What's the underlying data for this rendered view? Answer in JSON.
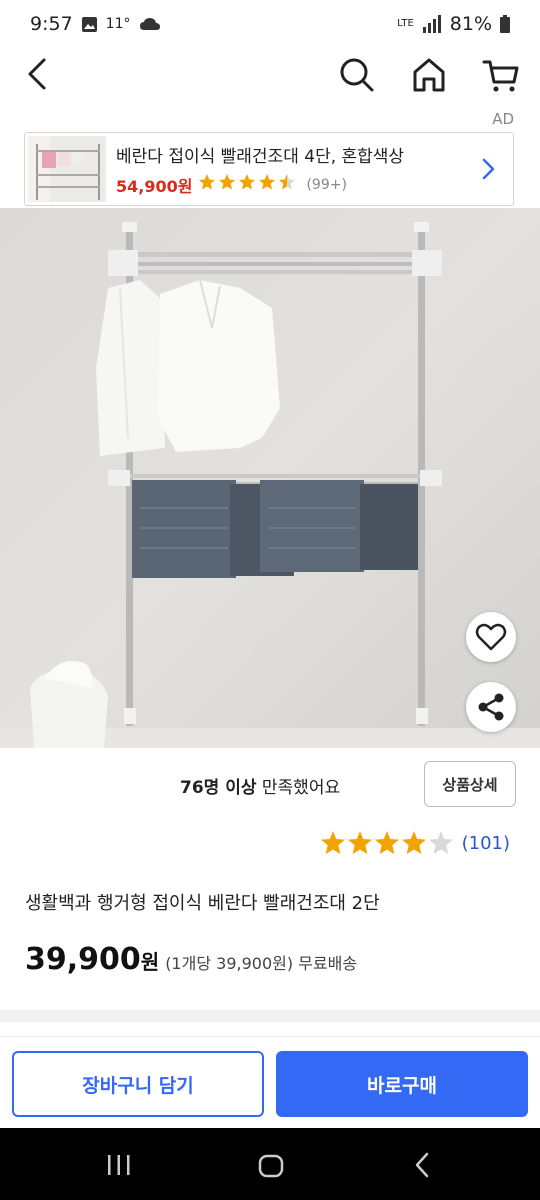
{
  "status_bar": {
    "time": "9:57",
    "temperature": "11°",
    "network": "LTE",
    "battery": "81%"
  },
  "nav": {
    "back_icon": "back-arrow-icon",
    "search_icon": "search-icon",
    "home_icon": "home-icon",
    "cart_icon": "cart-icon"
  },
  "ad": {
    "label": "AD",
    "title": "베란다 접이식 빨래건조대 4단, 혼합색상",
    "price": "54,900원",
    "rating": 4.5,
    "review_count": "(99+)"
  },
  "product": {
    "satisfaction_count": "76명 이상",
    "satisfaction_text": " 만족했어요",
    "detail_button": "상품상세",
    "rating": 4,
    "review_count": "(101)",
    "title": "생활백과 행거형 접이식 베란다 빨래건조대 2단",
    "price": "39,900",
    "price_unit": "원",
    "price_sub": "(1개당 39,900원) 무료배송"
  },
  "actions": {
    "cart_label": "장바구니 담기",
    "buy_label": "바로구매"
  },
  "colors": {
    "accent": "#3469f5",
    "star": "#f3a300",
    "ad_price": "#d92b1b"
  }
}
